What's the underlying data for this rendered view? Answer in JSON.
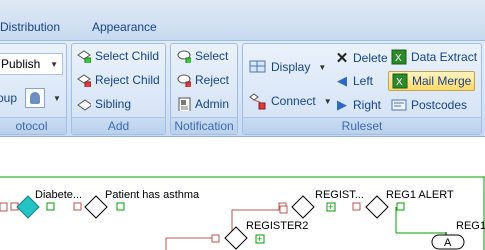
{
  "tabs": [
    "Distribution",
    "Appearance"
  ],
  "groups": {
    "protocol": {
      "label": "otocol",
      "publish": "Publish",
      "group": "oup"
    },
    "add": {
      "label": "Add",
      "select_child": "Select Child",
      "reject_child": "Reject Child",
      "sibling": "Sibling"
    },
    "notification": {
      "label": "Notification",
      "select": "Select",
      "reject": "Reject",
      "admin": "Admin"
    },
    "ruleset": {
      "label": "Ruleset",
      "display": "Display",
      "connect": "Connect",
      "delete": "Delete",
      "left": "Left",
      "right": "Right",
      "data_extract": "Data Extract",
      "mail_merge": "Mail Merge",
      "postcodes": "Postcodes"
    }
  },
  "canvas": {
    "nodes": {
      "diabetes": "Diabete...",
      "asthma": "Patient has asthma",
      "register_top": "REGIST...",
      "reg1_alert": "REG1 ALERT",
      "register2": "REGISTER2",
      "reg1": "REG1",
      "terminal": "A"
    }
  },
  "colors": {
    "accent": "#15428b",
    "selected_node": "#24c4c4",
    "red_connector": "#c0504d",
    "green_connector": "#00a000"
  }
}
